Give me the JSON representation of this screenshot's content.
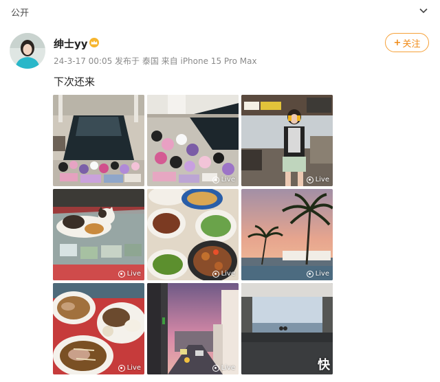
{
  "header": {
    "visibility": "公开",
    "chevron_icon": "chevron-down-icon"
  },
  "user": {
    "name": "绅士yy",
    "badge_icon": "crown-badge-icon"
  },
  "meta": {
    "text": "24-3-17 00:05  发布于 泰国  来自 iPhone 15 Pro Max"
  },
  "follow": {
    "plus": "+",
    "label": "关注"
  },
  "post": {
    "text": "下次还来"
  },
  "photos": [
    {
      "name": "pool-with-plush-toys",
      "live": false
    },
    {
      "name": "plush-toys-by-pool",
      "live": true,
      "live_label": "Live"
    },
    {
      "name": "girl-in-shop",
      "live": true,
      "live_label": "Live"
    },
    {
      "name": "cat-on-display-case",
      "live": true,
      "live_label": "Live"
    },
    {
      "name": "thai-food-table",
      "live": true,
      "live_label": "Live"
    },
    {
      "name": "sunset-palm-trees",
      "live": true,
      "live_label": "Live"
    },
    {
      "name": "noodle-soup-and-rice",
      "live": true,
      "live_label": "Live"
    },
    {
      "name": "street-at-dusk",
      "live": true,
      "live_label": "Live"
    },
    {
      "name": "sea-view-from-terrace",
      "live": false
    }
  ],
  "watermark": "快",
  "colors": {
    "accent": "#f08a16",
    "meta": "#8a8a8a"
  }
}
